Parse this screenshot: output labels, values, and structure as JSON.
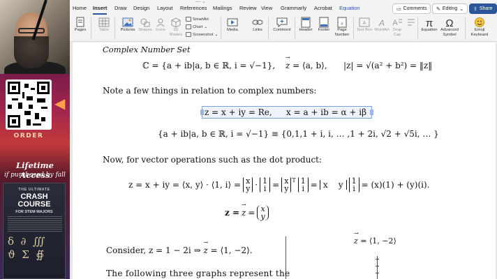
{
  "promo": {
    "order_label": "ORDER",
    "lifetime": "Lifetime Access",
    "purchased": "if purchased by fall",
    "course_ultimate": "THE ULTIMATE",
    "course_title_1": "CRASH COURSE",
    "course_sub": "FOR STEM MAJORS",
    "symbols": "δ  ∂  ∭\nϑ  Σ  ∯"
  },
  "word": {
    "title_partial": "— ⌄",
    "tabs": [
      "Home",
      "Insert",
      "Draw",
      "Design",
      "Layout",
      "References",
      "Mailings",
      "Review",
      "View",
      "Grammarly",
      "Acrobat",
      "Equation"
    ],
    "active_tab": "Insert",
    "context_tab": "Equation",
    "comments_label": "Comments",
    "editing_label": "Editing",
    "share_label": "Share",
    "ribbon": {
      "pages": "Pages",
      "table": "Table",
      "pictures": "Pictures",
      "shapes": "Shapes",
      "icons": "Icons",
      "models": "3D Models",
      "smartart": "SmartArt",
      "chart": "Chart",
      "screenshot": "Screenshot",
      "media": "Media",
      "links": "Links",
      "comment": "Comment",
      "header": "Header",
      "footer": "Footer",
      "page_number": "Page Number",
      "text_box": "Text Box",
      "wordart": "WordArt",
      "drop_cap": "Drop Cap",
      "equation": "Equation",
      "advanced_symbol": "Advanced Symbol",
      "emoji_keyboard": "Emoji Keyboard"
    }
  },
  "doc": {
    "heading": "Complex Number Set",
    "set_def": "ℂ = {a + ib|a, b ∈ ℝ, i = √−1},",
    "vec_def_rhs": " = ⟨a, b⟩,",
    "norm_def": "|z| = √(a² + b²) = ‖z‖",
    "note": "Note a few things in relation to complex numbers:",
    "eq_selected_1": "z = x + iy = Re,",
    "eq_selected_2": "x = a + ib = α + iβ",
    "set_example": "{a + ib|a, b ∈ ℝ, i = √−1} ≡ {0,1,1 + i, i, … ,1 + 2i, √2 + √5i, … }",
    "dot_intro": "Now, for vector operations such as the dot product:",
    "dot_eq_lhs": "z = x + iy = ⟨x, y⟩ · ⟨1, i⟩ =",
    "dot_eq_rhs": "= (x)(1) + (y)(i).",
    "matrix_x": "x",
    "matrix_y": "y",
    "matrix_1": "1",
    "matrix_i": "i",
    "row_vec": "x    y",
    "z_vec_lhs": "z =",
    "z_vec_eq": " =",
    "consider": "Consider, z = 1 − 2i  ⇒  ",
    "consider_rhs": " = ⟨1, −2⟩.",
    "graph_label": " = ⟨1, −2⟩",
    "graphs_text": "The following three graphs represent the"
  }
}
